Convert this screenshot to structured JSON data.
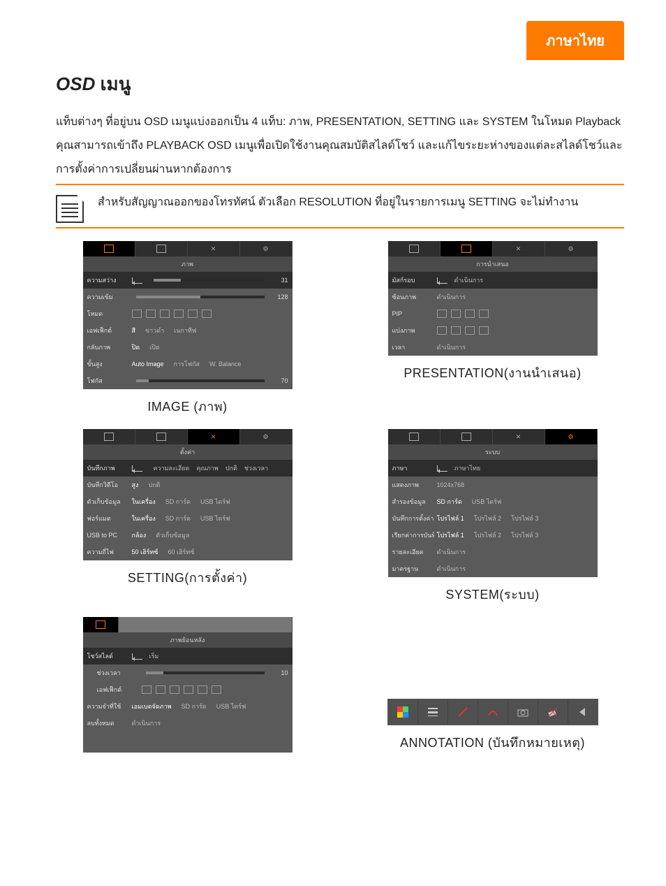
{
  "header": {
    "lang_tab": "ภาษาไทย"
  },
  "title": {
    "osd": "OSD",
    "rest": " เมนู"
  },
  "intro": "แท็บต่างๆ ที่อยู่บน OSD เมนูแบ่งออกเป็น 4 แท็บ: ภาพ, PRESENTATION, SETTING และ SYSTEM ในโหมด Playback คุณสามารถเข้าถึง PLAYBACK OSD เมนูเพื่อเปิดใช้งานคุณสมบัติสไลด์โชว์ และแก้ไขระยะห่างของแต่ละสไลด์โชว์และการตั้งค่าการเปลี่ยนผ่านหากต้องการ",
  "note": "สำหรับสัญญาณออกของโทรทัศน์ ตัวเลือก RESOLUTION ที่อยู่ในรายการเมนู SETTING จะไม่ทำงาน",
  "captions": {
    "image": "IMAGE (ภาพ)",
    "presentation": "PRESENTATION(งานนำเสนอ)",
    "setting": "SETTING(การตั้งค่า)",
    "system": "SYSTEM(ระบบ)",
    "annotation": "ANNOTATION (บันทึกหมายเหตุ)"
  },
  "osd": {
    "image": {
      "tab_title": "ภาพ",
      "rows": [
        {
          "label": "ความสว่าง",
          "type": "slider",
          "value": 31,
          "pct": 25
        },
        {
          "label": "ความเข้ม",
          "type": "slider_plain",
          "value": 128,
          "pct": 50
        },
        {
          "label": "โหมด",
          "type": "icons"
        },
        {
          "label": "เอฟเฟ็กต์",
          "type": "opts",
          "opts": [
            "สี",
            "ขาวดำ",
            "เนกาทีฟ"
          ]
        },
        {
          "label": "กลับภาพ",
          "type": "opts",
          "opts": [
            "ปิด",
            "เปิด"
          ]
        },
        {
          "label": "ขั้นสูง",
          "type": "opts",
          "opts": [
            "Auto Image",
            "การโฟกัส",
            "W. Balance"
          ]
        },
        {
          "label": "โฟกัส",
          "type": "slider_plain",
          "value": 70,
          "pct": 10
        }
      ]
    },
    "presentation": {
      "tab_title": "การนำเสนอ",
      "rows": [
        {
          "label": "มัสก์รอบ",
          "type": "enter",
          "val": "ดำเนินการ"
        },
        {
          "label": "ซ้อนภาพ",
          "type": "text",
          "val": "ดำเนินการ"
        },
        {
          "label": "PIP",
          "type": "boxes4"
        },
        {
          "label": "แบ่งภาพ",
          "type": "boxes4b"
        },
        {
          "label": "เวลา",
          "type": "text",
          "val": "ดำเนินการ"
        }
      ]
    },
    "setting": {
      "tab_title": "ตั้งค่า",
      "rows": [
        {
          "label": "บันทึกภาพ",
          "type": "enter_opts",
          "opts": [
            "ความละเอียด",
            "คุณภาพ",
            "ปกติ",
            "ช่วงเวลา"
          ]
        },
        {
          "label": "บันทึกวิดีโอ",
          "type": "opts",
          "opts": [
            "สูง",
            "ปกติ"
          ]
        },
        {
          "label": "ตัวเก็บข้อมูล",
          "type": "opts",
          "opts": [
            "ในเครื่อง",
            "SD การ์ด",
            "USB ไดร์ฟ"
          ]
        },
        {
          "label": "ฟอร์แมต",
          "type": "opts",
          "opts": [
            "ในเครื่อง",
            "SD การ์ด",
            "USB ไดร์ฟ"
          ]
        },
        {
          "label": "USB to PC",
          "type": "opts",
          "opts": [
            "กล้อง",
            "ตัวเก็บข้อมูล"
          ]
        },
        {
          "label": "ความถี่ไฟ",
          "type": "opts",
          "opts": [
            "50 เฮิร์ทซ์",
            "60 เฮิร์ทซ์"
          ]
        }
      ]
    },
    "system": {
      "tab_title": "ระบบ",
      "rows": [
        {
          "label": "ภาษา",
          "type": "enter",
          "val": "ภาษาไทย"
        },
        {
          "label": "แสดงภาพ",
          "type": "text",
          "val": "1024x768"
        },
        {
          "label": "สำรองข้อมูล",
          "type": "opts",
          "opts": [
            "SD การ์ด",
            "USB ไดร์ฟ"
          ]
        },
        {
          "label": "บันทึกการตั้งค่า",
          "type": "opts",
          "opts": [
            "โปรไฟล์ 1",
            "โปรไฟล์ 2",
            "โปรไฟล์ 3"
          ]
        },
        {
          "label": "เรียกค่าการบันทึก",
          "type": "opts",
          "opts": [
            "โปรไฟล์ 1",
            "โปรไฟล์ 2",
            "โปรไฟล์ 3"
          ]
        },
        {
          "label": "รายละเอียด",
          "type": "text",
          "val": "ดำเนินการ"
        },
        {
          "label": "มาตรฐาน",
          "type": "text",
          "val": "ดำเนินการ"
        }
      ]
    },
    "playback": {
      "tab_title": "ภาพย้อนหลัง",
      "rows": [
        {
          "label": "โชว์สไลด์",
          "type": "enter",
          "val": "เริ่ม"
        },
        {
          "label": "ช่วงเวลา",
          "type": "slider_plain",
          "value": 10,
          "pct": 15,
          "indent": true
        },
        {
          "label": "เอฟเฟ็กต์",
          "type": "icons",
          "indent": true
        },
        {
          "label": "ความจำที่ใช้",
          "type": "opts",
          "opts": [
            "เอมเบดจัดภาพ",
            "SD การ์ด",
            "USB ไดร์ฟ"
          ]
        },
        {
          "label": "ลบทั้งหมด",
          "type": "text",
          "val": "ดำเนินการ"
        }
      ]
    }
  },
  "anno_icons": [
    "color",
    "lines",
    "redline",
    "sline",
    "camera",
    "erase",
    "back"
  ]
}
